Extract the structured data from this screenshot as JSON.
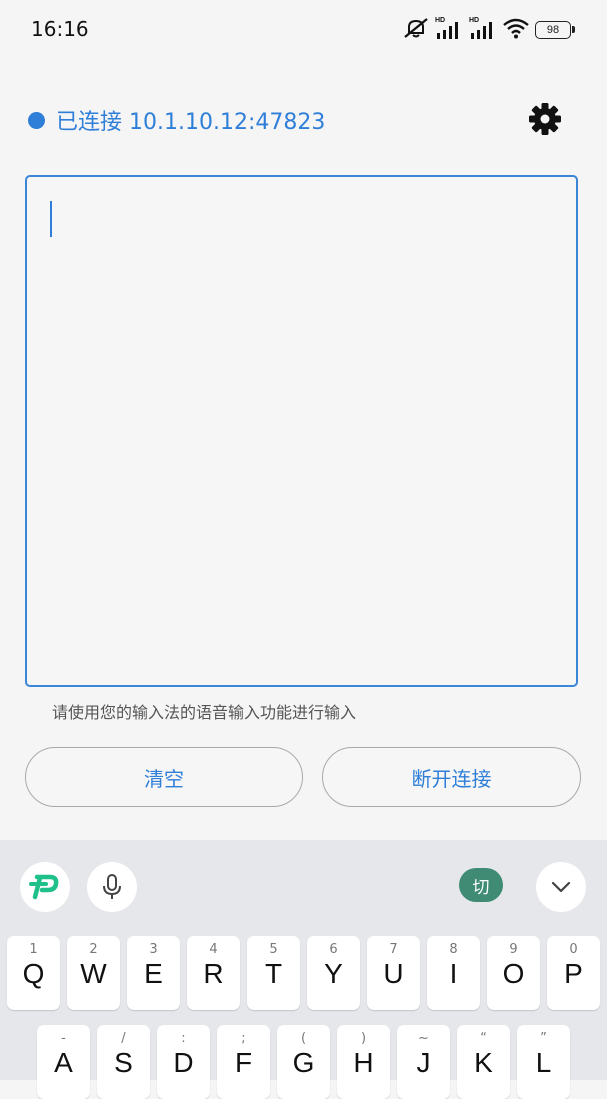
{
  "status_bar": {
    "time": "16:16",
    "hd1": "HD",
    "hd2": "HD",
    "battery": "98"
  },
  "connection": {
    "status_text": "已连接 10.1.10.12:47823",
    "accent": "#2f7fd8"
  },
  "input": {
    "helper": "请使用您的输入法的语音输入功能进行输入"
  },
  "buttons": {
    "clear": "清空",
    "disconnect": "断开连接"
  },
  "keyboard": {
    "switch_label": "切",
    "row1": [
      {
        "hint": "1",
        "key": "Q"
      },
      {
        "hint": "2",
        "key": "W"
      },
      {
        "hint": "3",
        "key": "E"
      },
      {
        "hint": "4",
        "key": "R"
      },
      {
        "hint": "5",
        "key": "T"
      },
      {
        "hint": "6",
        "key": "Y"
      },
      {
        "hint": "7",
        "key": "U"
      },
      {
        "hint": "8",
        "key": "I"
      },
      {
        "hint": "9",
        "key": "O"
      },
      {
        "hint": "0",
        "key": "P"
      }
    ],
    "row2": [
      {
        "hint": "-",
        "key": "A"
      },
      {
        "hint": "/",
        "key": "S"
      },
      {
        "hint": ":",
        "key": "D"
      },
      {
        "hint": ";",
        "key": "F"
      },
      {
        "hint": "(",
        "key": "G"
      },
      {
        "hint": ")",
        "key": "H"
      },
      {
        "hint": "~",
        "key": "J"
      },
      {
        "hint": "“",
        "key": "K"
      },
      {
        "hint": "”",
        "key": "L"
      }
    ]
  }
}
